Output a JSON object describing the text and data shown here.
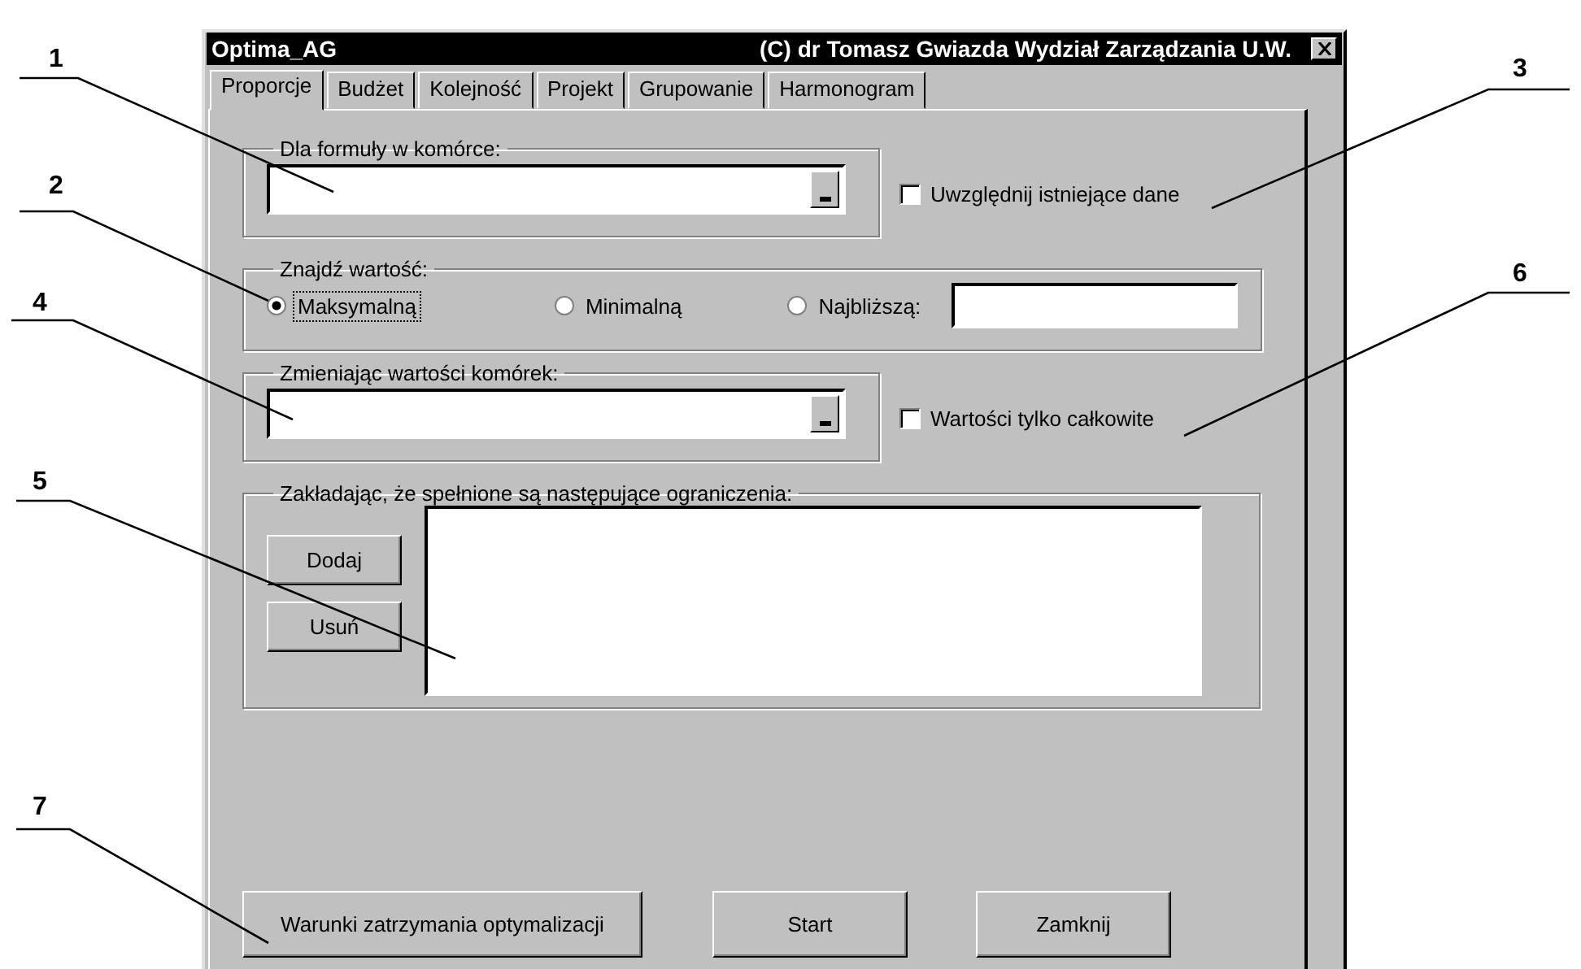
{
  "window": {
    "title": "Optima_AG",
    "copyright": "(C) dr Tomasz Gwiazda Wydział Zarządzania U.W."
  },
  "tabs": [
    {
      "label": "Proporcje",
      "selected": true
    },
    {
      "label": "Budżet",
      "selected": false
    },
    {
      "label": "Kolejność",
      "selected": false
    },
    {
      "label": "Projekt",
      "selected": false
    },
    {
      "label": "Grupowanie",
      "selected": false
    },
    {
      "label": "Harmonogram",
      "selected": false
    }
  ],
  "formula_group": {
    "label": "Dla formuły w komórce:"
  },
  "include_existing": {
    "label": "Uwzględnij istniejące dane",
    "checked": false
  },
  "find_group": {
    "label": "Znajdź wartość:",
    "options": [
      {
        "label": "Maksymalną",
        "selected": true
      },
      {
        "label": "Minimalną",
        "selected": false
      },
      {
        "label": "Najbliższą:",
        "selected": false
      }
    ]
  },
  "changing_group": {
    "label": "Zmieniając wartości komórek:"
  },
  "integer_only": {
    "label": "Wartości tylko całkowite",
    "checked": false
  },
  "constraints_group": {
    "label": "Zakładając, że spełnione są następujące ograniczenia:",
    "buttons": [
      "Dodaj",
      "Usuń"
    ]
  },
  "buttons": [
    "Warunki zatrzymania optymalizacji",
    "Start",
    "Zamknij"
  ],
  "callouts": [
    {
      "number": "1"
    },
    {
      "number": "3"
    },
    {
      "number": "2"
    },
    {
      "number": "6"
    },
    {
      "number": "4"
    },
    {
      "number": "5"
    },
    {
      "number": "7"
    }
  ]
}
